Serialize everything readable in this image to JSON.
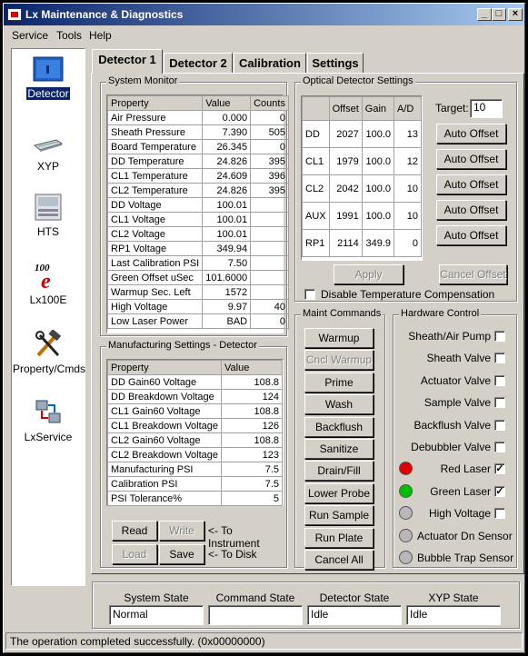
{
  "window": {
    "title": "Lx Maintenance & Diagnostics"
  },
  "menu": [
    "Service",
    "Tools",
    "Help"
  ],
  "sidebar": [
    {
      "label": "Detector",
      "icon": "detector-icon"
    },
    {
      "label": "XYP",
      "icon": "xyp-plate-icon"
    },
    {
      "label": "HTS",
      "icon": "hts-icon"
    },
    {
      "label": "Lx100E",
      "icon": "lx100e-icon"
    },
    {
      "label": "Property/Cmds",
      "icon": "tools-icon"
    },
    {
      "label": "LxService",
      "icon": "network-icon"
    }
  ],
  "tabs": [
    "Detector 1",
    "Detector 2",
    "Calibration",
    "Settings"
  ],
  "system_monitor": {
    "title": "System Monitor",
    "headers": [
      "Property",
      "Value",
      "Counts"
    ],
    "rows": [
      [
        "Air Pressure",
        "0.000",
        "0"
      ],
      [
        "Sheath Pressure",
        "7.390",
        "505"
      ],
      [
        "Board Temperature",
        "26.345",
        "0"
      ],
      [
        "DD Temperature",
        "24.826",
        "395"
      ],
      [
        "CL1 Temperature",
        "24.609",
        "396"
      ],
      [
        "CL2 Temperature",
        "24.826",
        "395"
      ],
      [
        "DD Voltage",
        "100.01",
        ""
      ],
      [
        "CL1 Voltage",
        "100.01",
        ""
      ],
      [
        "CL2 Voltage",
        "100.01",
        ""
      ],
      [
        "RP1 Voltage",
        "349.94",
        ""
      ],
      [
        "Last Calibration PSI",
        "7.50",
        ""
      ],
      [
        "Green Offset uSec",
        "101.6000",
        ""
      ],
      [
        "Warmup Sec. Left",
        "1572",
        ""
      ],
      [
        "High Voltage",
        "9.97",
        "40"
      ],
      [
        "Low Laser Power",
        "BAD",
        "0"
      ]
    ]
  },
  "optical": {
    "title": "Optical Detector Settings",
    "headers": [
      "",
      "Offset",
      "Gain",
      "A/D"
    ],
    "rows": [
      [
        "DD",
        "2027",
        "100.0",
        "13"
      ],
      [
        "CL1",
        "1979",
        "100.0",
        "12"
      ],
      [
        "CL2",
        "2042",
        "100.0",
        "10"
      ],
      [
        "AUX",
        "1991",
        "100.0",
        "10"
      ],
      [
        "RP1",
        "2114",
        "349.9",
        "0"
      ]
    ],
    "target_label": "Target:",
    "target_value": "10",
    "auto_offset_label": "Auto Offset",
    "apply_label": "Apply",
    "cancel_offset_label": "Cancel Offset",
    "disable_temp_label": "Disable Temperature Compensation"
  },
  "manufacturing": {
    "title": "Manufacturing Settings - Detector",
    "headers": [
      "Property",
      "Value"
    ],
    "rows": [
      [
        "DD Gain60 Voltage",
        "108.8"
      ],
      [
        "DD Breakdown Voltage",
        "124"
      ],
      [
        "CL1 Gain60 Voltage",
        "108.8"
      ],
      [
        "CL1 Breakdown Voltage",
        "126"
      ],
      [
        "CL2 Gain60 Voltage",
        "108.8"
      ],
      [
        "CL2 Breakdown Voltage",
        "123"
      ],
      [
        "Manufacturing PSI",
        "7.5"
      ],
      [
        "Calibration PSI",
        "7.5"
      ],
      [
        "PSI Tolerance%",
        "5"
      ]
    ],
    "read": "Read",
    "write": "Write",
    "to_instrument": "<- To Instrument",
    "load": "Load",
    "save": "Save",
    "to_disk": "<- To Disk"
  },
  "maint": {
    "title": "Maint Commands",
    "buttons": [
      "Warmup",
      "Cncl Warmup",
      "Prime",
      "Wash",
      "Backflush",
      "Sanitize",
      "Drain/Fill",
      "Lower Probe",
      "Run Sample",
      "Run Plate",
      "Cancel All"
    ]
  },
  "hardware": {
    "title": "Hardware Control",
    "checks": [
      {
        "label": "Sheath/Air Pump",
        "checked": false
      },
      {
        "label": "Sheath Valve",
        "checked": false
      },
      {
        "label": "Actuator Valve",
        "checked": false
      },
      {
        "label": "Sample Valve",
        "checked": false
      },
      {
        "label": "Backflush Valve",
        "checked": false
      },
      {
        "label": "Debubbler Valve",
        "checked": false
      },
      {
        "label": "Red Laser",
        "checked": true,
        "led": "#e00000"
      },
      {
        "label": "Green Laser",
        "checked": true,
        "led": "#00c000"
      },
      {
        "label": "High Voltage",
        "checked": false,
        "led": "#b8b8b8"
      }
    ],
    "sensors": [
      {
        "label": "Actuator Dn Sensor",
        "led": "#b8b8b8"
      },
      {
        "label": "Bubble Trap Sensor",
        "led": "#b8b8b8"
      }
    ]
  },
  "states": [
    {
      "label": "System State",
      "value": "Normal"
    },
    {
      "label": "Command State",
      "value": ""
    },
    {
      "label": "Detector State",
      "value": "Idle"
    },
    {
      "label": "XYP State",
      "value": "Idle"
    }
  ],
  "status": "The operation completed successfully.  (0x00000000)"
}
